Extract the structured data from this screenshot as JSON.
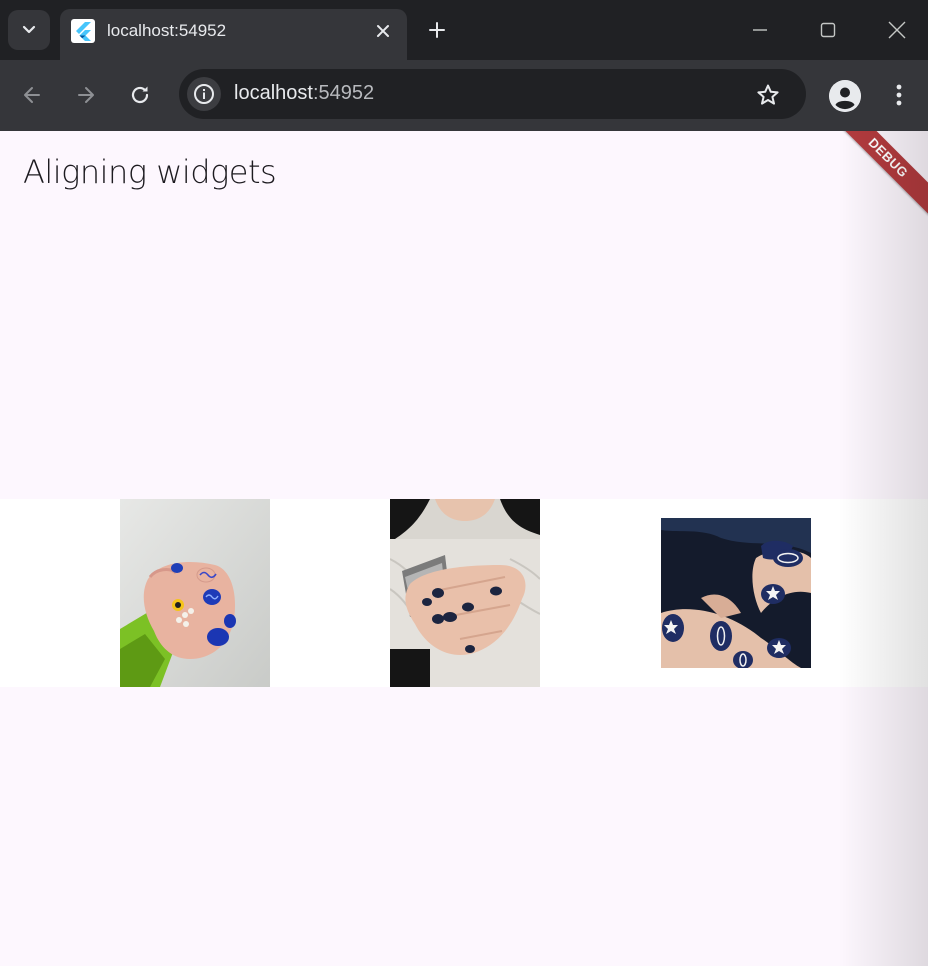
{
  "browser": {
    "tab_title": "localhost:54952",
    "url_host": "localhost",
    "url_port": ":54952",
    "icons": [
      "tab-search-icon",
      "flutter-icon",
      "close-icon",
      "plus-icon",
      "minimize-icon",
      "maximize-icon",
      "close-window-icon",
      "back-arrow-icon",
      "forward-arrow-icon",
      "reload-icon",
      "info-icon",
      "star-icon",
      "profile-icon",
      "more-vert-icon"
    ]
  },
  "app": {
    "title": "Aligning widgets",
    "debug_banner": "DEBUG",
    "background_color": "#fdf7fe",
    "row_background_color": "#ffffff",
    "images": [
      {
        "name": "nails-green-sleeve"
      },
      {
        "name": "nails-holding-phone"
      },
      {
        "name": "nails-star-art"
      }
    ]
  }
}
